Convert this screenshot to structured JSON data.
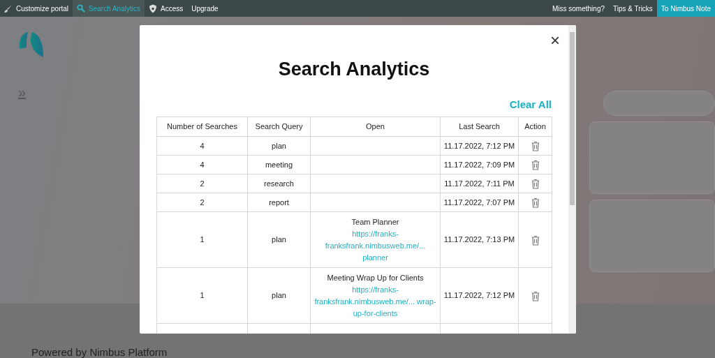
{
  "topbar": {
    "left": [
      {
        "kind": "brush",
        "label": "Customize portal",
        "selected": false
      },
      {
        "kind": "search",
        "label": "Search Analytics",
        "selected": true
      },
      {
        "kind": "shield",
        "label": "Access",
        "selected": false
      },
      {
        "kind": "none",
        "label": "Upgrade",
        "selected": false
      }
    ],
    "right": [
      {
        "label": "Miss something?",
        "kind": "plain"
      },
      {
        "label": "Tips & Tricks",
        "kind": "plain"
      },
      {
        "label": "To Nimbus Note",
        "kind": "accent"
      }
    ]
  },
  "sidebar": {
    "toggle": "»"
  },
  "footer": {
    "text": "Powered by Nimbus Platform"
  },
  "modal": {
    "title": "Search Analytics",
    "close": "×",
    "clear_all": "Clear All",
    "table": {
      "columns": [
        "Number of Searches",
        "Search Query",
        "Open",
        "Last Search",
        "Action"
      ],
      "rows": [
        {
          "count": "4",
          "query": "plan",
          "last": "11.17.2022, 7:12 PM"
        },
        {
          "count": "4",
          "query": "meeting",
          "last": "11.17.2022, 7:09 PM"
        },
        {
          "count": "2",
          "query": "research",
          "last": "11.17.2022, 7:11 PM"
        },
        {
          "count": "2",
          "query": "report",
          "last": "11.17.2022, 7:07 PM"
        },
        {
          "count": "1",
          "query": "plan",
          "open_title": "Team Planner",
          "open_link": "https://franks- franksfrank.nimbusweb.me/... planner",
          "last": "11.17.2022, 7:13 PM"
        },
        {
          "count": "1",
          "query": "plan",
          "open_title": "Meeting Wrap Up for Clients",
          "open_link": "https://franks- franksfrank.nimbusweb.me/... wrap-up-for-clients",
          "last": "11.17.2022, 7:12 PM"
        }
      ]
    }
  }
}
